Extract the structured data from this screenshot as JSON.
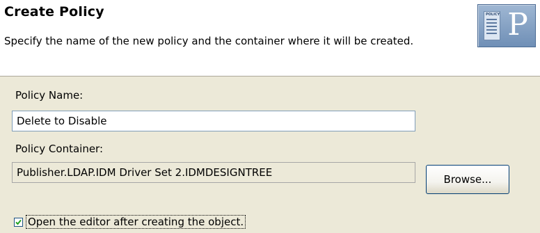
{
  "header": {
    "title": "Create Policy",
    "description": "Specify the name of the new policy and the container where it will be created.",
    "icon": "policy-icon",
    "icon_doc_label": "POLICY",
    "icon_letter": "P"
  },
  "form": {
    "policy_name_label": "Policy Name:",
    "policy_name_value": "Delete to Disable",
    "policy_container_label": "Policy Container:",
    "policy_container_value": "Publisher.LDAP.IDM Driver Set 2.IDMDESIGNTREE",
    "browse_button_label": "Browse...",
    "open_editor_label": "Open the editor after creating the object.",
    "open_editor_checked": true
  },
  "colors": {
    "header_bg": "#ffffff",
    "panel_bg": "#ece9d8",
    "icon_bg": "#6f8fb6",
    "checkbox_check": "#21a121"
  }
}
